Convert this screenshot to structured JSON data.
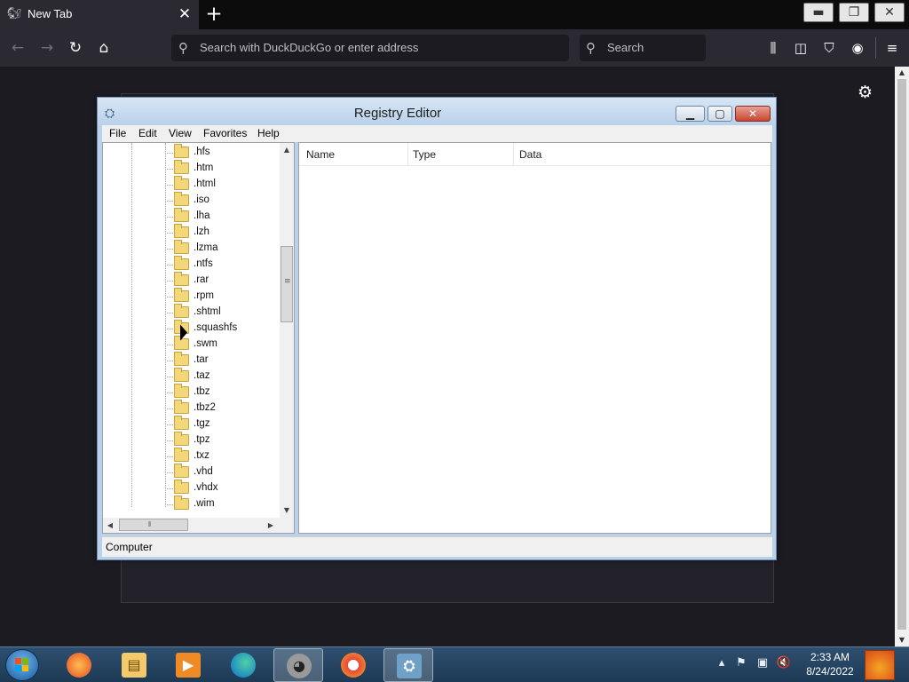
{
  "browser": {
    "tab_title": "New Tab",
    "tab_close_glyph": "✕",
    "new_tab_glyph": "+",
    "url_placeholder": "Search with DuckDuckGo or enter address",
    "search_placeholder": "Search",
    "icons": [
      "back-icon",
      "forward-icon",
      "reload-icon",
      "home-icon",
      "library-icon",
      "sidebar-icon",
      "ublock-icon",
      "private-mask-icon",
      "menu-icon",
      "settings-gear-icon"
    ]
  },
  "window_controls": {
    "minimize": "▭",
    "restore": "❐",
    "close": "✕"
  },
  "registry_editor": {
    "title": "Registry Editor",
    "menu": [
      "File",
      "Edit",
      "View",
      "Favorites",
      "Help"
    ],
    "tree_items": [
      ".hfs",
      ".htm",
      ".html",
      ".iso",
      ".lha",
      ".lzh",
      ".lzma",
      ".ntfs",
      ".rar",
      ".rpm",
      ".shtml",
      ".squashfs",
      ".swm",
      ".tar",
      ".taz",
      ".tbz",
      ".tbz2",
      ".tgz",
      ".tpz",
      ".txz",
      ".vhd",
      ".vhdx",
      ".wim"
    ],
    "columns": [
      "Name",
      "Type",
      "Data"
    ],
    "status": "Computer"
  },
  "taskbar": {
    "apps": [
      "firefox-icon",
      "file-explorer-icon",
      "media-player-icon",
      "edge-icon",
      "raccoon-app-icon",
      "avast-secure-browser-icon",
      "registry-editor-icon"
    ],
    "tray": [
      "show-hidden-icons",
      "action-center-flag-icon",
      "network-icon",
      "volume-muted-icon"
    ],
    "time": "2:33 AM",
    "date": "8/24/2022"
  }
}
